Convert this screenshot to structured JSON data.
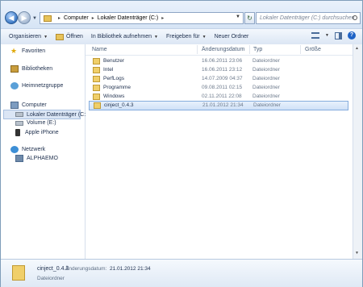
{
  "address": {
    "crumbs": [
      "Computer",
      "Lokaler Datenträger (C:)"
    ],
    "search_placeholder": "Lokaler Datenträger (C:) durchsuchen"
  },
  "toolbar": {
    "organize": "Organisieren",
    "open": "Öffnen",
    "include_library": "In Bibliothek aufnehmen",
    "share": "Freigeben für",
    "new_folder": "Neuer Ordner"
  },
  "nav": {
    "favorites": "Favoriten",
    "libraries": "Bibliotheken",
    "homegroup": "Heimnetzgruppe",
    "computer": "Computer",
    "local_disk": "Lokaler Datenträger (C:)",
    "volume_e": "Volume (E:)",
    "iphone": "Apple iPhone",
    "network": "Netzwerk",
    "host": "ALPHAEMO"
  },
  "columns": {
    "name": "Name",
    "date": "Änderungsdatum",
    "type": "Typ",
    "size": "Größe"
  },
  "files": [
    {
      "name": "Benutzer",
      "date": "16.06.2011 23:06",
      "type": "Dateiordner"
    },
    {
      "name": "Intel",
      "date": "16.06.2011 23:12",
      "type": "Dateiordner"
    },
    {
      "name": "PerfLogs",
      "date": "14.07.2009 04:37",
      "type": "Dateiordner"
    },
    {
      "name": "Programme",
      "date": "09.08.2011 02:15",
      "type": "Dateiordner"
    },
    {
      "name": "Windows",
      "date": "02.11.2011 22:08",
      "type": "Dateiordner"
    },
    {
      "name": "cinject_0.4.3",
      "date": "21.01.2012 21:34",
      "type": "Dateiordner"
    }
  ],
  "details": {
    "name": "cinject_0.4.3",
    "date_label": "Änderungsdatum:",
    "date": "21.01.2012 21:34",
    "type": "Dateiordner"
  }
}
